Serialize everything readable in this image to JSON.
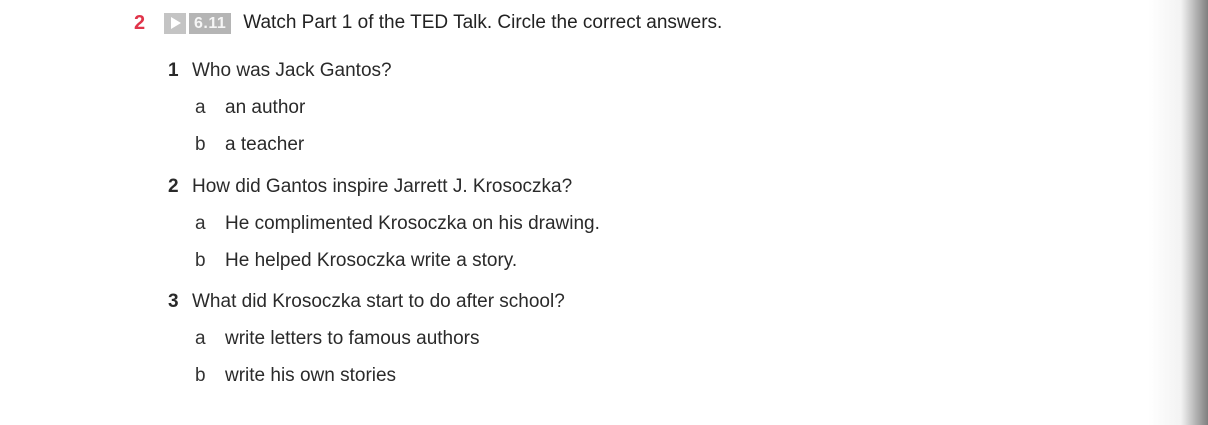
{
  "exercise": {
    "number": "2",
    "video_code": "6.11",
    "instruction": "Watch Part 1 of the TED Talk. Circle the correct answers.",
    "play_icon": "play-icon"
  },
  "questions": [
    {
      "number": "1",
      "text": "Who was Jack Gantos?",
      "options": [
        {
          "letter": "a",
          "text": "an author"
        },
        {
          "letter": "b",
          "text": "a teacher"
        }
      ]
    },
    {
      "number": "2",
      "text": "How did Gantos inspire Jarrett J. Krosoczka?",
      "options": [
        {
          "letter": "a",
          "text": "He complimented Krosoczka on his drawing."
        },
        {
          "letter": "b",
          "text": "He helped Krosoczka write a story."
        }
      ]
    },
    {
      "number": "3",
      "text": "What did Krosoczka start to do after school?",
      "options": [
        {
          "letter": "a",
          "text": "write letters to famous authors"
        },
        {
          "letter": "b",
          "text": "write his own stories"
        }
      ]
    }
  ],
  "colors": {
    "exercise_number": "#e0344a",
    "badge": "#b5b5b5",
    "play_icon": "#c4c4c4"
  }
}
